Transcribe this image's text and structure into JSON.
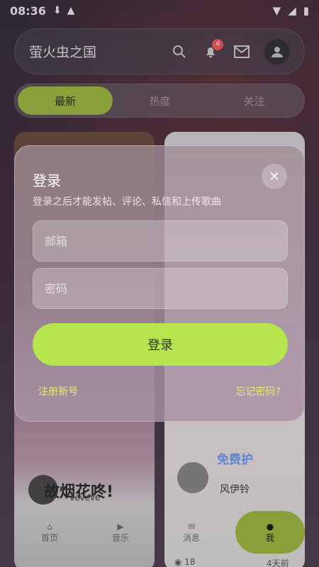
{
  "status": {
    "time": "08:36"
  },
  "topbar": {
    "title": "萤火虫之国",
    "notification_count": "4"
  },
  "tabs": [
    {
      "label": "最新",
      "active": true
    },
    {
      "label": "热度",
      "active": false
    },
    {
      "label": "关注",
      "active": false
    }
  ],
  "cards": [
    {
      "title": "故烟花咚!",
      "author": "veveve"
    },
    {
      "promo": "免费护",
      "author": "风伊铃",
      "views": "18",
      "time": "4天前"
    }
  ],
  "nav": [
    {
      "label": "首页"
    },
    {
      "label": "音乐"
    },
    {
      "label": "消息"
    },
    {
      "label": "我"
    }
  ],
  "dialog": {
    "title": "登录",
    "subtitle": "登录之后才能发帖、评论、私信和上传歌曲",
    "email_placeholder": "邮箱",
    "password_placeholder": "密码",
    "login_label": "登录",
    "register_label": "注册新号",
    "forgot_label": "忘记密码?"
  },
  "colors": {
    "accent": "#a5c43a",
    "login_button": "#b7e54e",
    "link": "#d7f070"
  }
}
